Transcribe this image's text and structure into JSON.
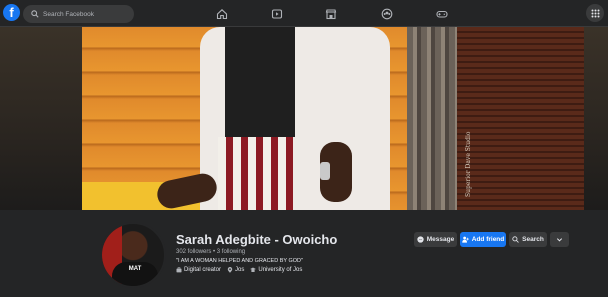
{
  "nav": {
    "search_placeholder": "Search Facebook",
    "logo_letter": "f"
  },
  "cover": {
    "sign_text": "Superior Dave Studio"
  },
  "profile": {
    "name": "Sarah Adegbite - Owoicho",
    "follows": "302 followers • 3 following",
    "bio": "\"I AM A WOMAN HELPED AND GRACED BY GOD\"",
    "tags": [
      {
        "icon": "briefcase-icon",
        "label": "Digital creator"
      },
      {
        "icon": "location-pin-icon",
        "label": "Jos"
      },
      {
        "icon": "school-icon",
        "label": "University of Jos"
      }
    ],
    "avatar_shirt_text": "MAT"
  },
  "actions": {
    "message": "Message",
    "add_friend": "Add friend",
    "search": "Search"
  },
  "colors": {
    "accent": "#1877f2",
    "background": "#18191a",
    "surface": "#242526",
    "button": "#3a3b3c"
  }
}
